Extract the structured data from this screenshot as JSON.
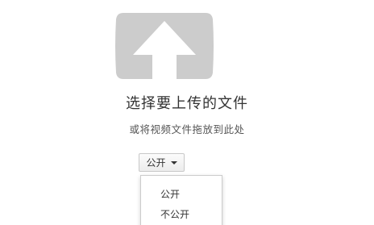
{
  "upload": {
    "icon": "upload-arrow-icon",
    "icon_color": "#cccccc",
    "title": "选择要上传的文件",
    "subtitle": "或将视频文件拖放到此处"
  },
  "privacy": {
    "selected_label": "公开",
    "menu_open": true,
    "options": [
      "公开",
      "不公开"
    ]
  }
}
